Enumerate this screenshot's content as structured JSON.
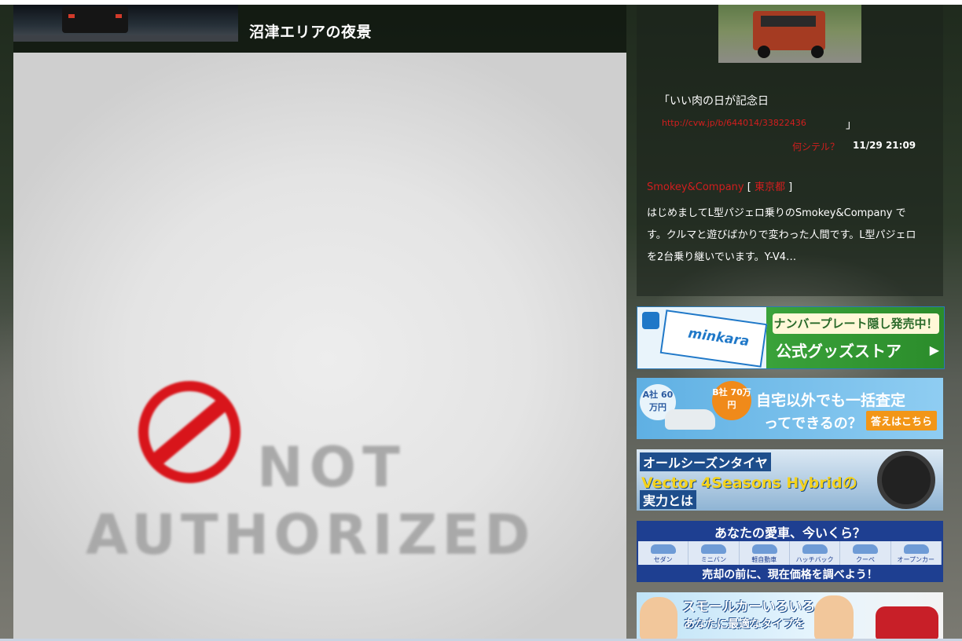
{
  "post": {
    "title": "沼津エリアの夜景"
  },
  "main_image": {
    "text_line1": "NOT",
    "text_line2": "AUTHORIZED"
  },
  "profile": {
    "message": "「いい肉の日が記念日",
    "message_link": "http://cvw.jp/b/644014/33822436",
    "message_close": "」",
    "meta_link": "何シテル？",
    "meta_date": "11/29 21:09",
    "user_name": "Smokey&Company",
    "user_region": "東京都",
    "intro": "はじめましてL型パジェロ乗りのSmokey&Company です。クルマと遊びばかりで変わった人間です。L型パジェロを2台乗り継いでいます。Y-V4…"
  },
  "banners": {
    "b1": {
      "logo": "minkara",
      "line1": "ナンバープレート隠し発売中！",
      "line2": "公式グッズストア",
      "arrow": "▶"
    },
    "b2": {
      "a_label": "A社 60万円",
      "b_label": "B社 70万円",
      "line1": "自宅以外でも一括査定",
      "line2": "ってできるの？",
      "cta": "答えはこちら"
    },
    "b3": {
      "line1": "オールシーズンタイヤ",
      "line2": "Vector 4Seasons Hybridの",
      "line3": "実力とは"
    },
    "b4": {
      "line1": "あなたの愛車、今いくら？",
      "categories": [
        "セダン",
        "ミニバン",
        "軽自動車",
        "ハッチバック",
        "クーペ",
        "オープンカー"
      ],
      "line2": "売却の前に、現在価格を調べよう！"
    },
    "b5": {
      "line1": "スモールカーいろいろ",
      "line2": "あなたに最適なタイプを"
    }
  }
}
